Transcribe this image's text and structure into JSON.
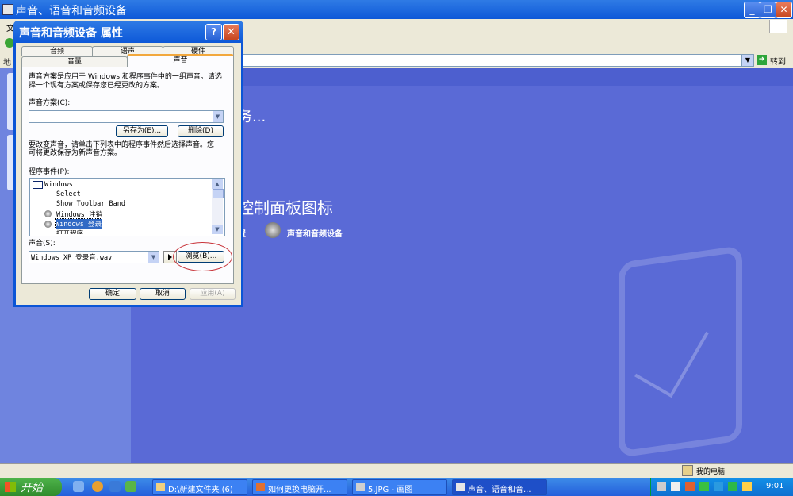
{
  "back_window": {
    "title": "声音、语音和音频设备",
    "menu_first": "文",
    "address_label": "地",
    "go_label": "转到",
    "task_text": "务...",
    "cp_heading": "控制面板图标",
    "cp_link1": "置",
    "cp_link2": "声音和音频设备",
    "status_mycomputer": "我的电脑"
  },
  "dialog": {
    "title": "声音和音频设备 属性",
    "help": "?",
    "close": "✕",
    "tabs_back": [
      "音频",
      "语声",
      "硬件"
    ],
    "tabs_front": [
      "音量",
      "声音"
    ],
    "active_tab": "声音",
    "scheme_desc": [
      "声音方案是应用于 Windows 和程序事件中的一组声音。请选",
      "择一个现有方案或保存您已经更改的方案。"
    ],
    "scheme_label": "声音方案(C):",
    "scheme_value": "",
    "save_as": "另存为(E)...",
    "delete": "删除(D)",
    "change_desc": [
      "要改变声音，请单击下列表中的程序事件然后选择声音。您",
      "可将更改保存为新声音方案。"
    ],
    "events_label": "程序事件(P):",
    "events": [
      "Windows",
      "Select",
      "Show Toolbar Band",
      "Windows 注销",
      "Windows 登录",
      "打开程序"
    ],
    "selected_event": "Windows 登录",
    "sound_label": "声音(S):",
    "sound_value": "Windows XP 登录音.wav",
    "browse": "浏览(B)...",
    "ok": "确定",
    "cancel": "取消",
    "apply": "应用(A)"
  },
  "taskbar": {
    "start": "开始",
    "items": [
      "D:\\新建文件夹 (6)",
      "如何更换电脑开...",
      "5.JPG - 画图",
      "声音、语音和音..."
    ],
    "clock": "9:01"
  },
  "colors": {
    "xp_blue": "#0d58d8",
    "content_bg": "#5a6ad6",
    "selection": "#316ac5",
    "annotation_red": "#c8343a"
  }
}
